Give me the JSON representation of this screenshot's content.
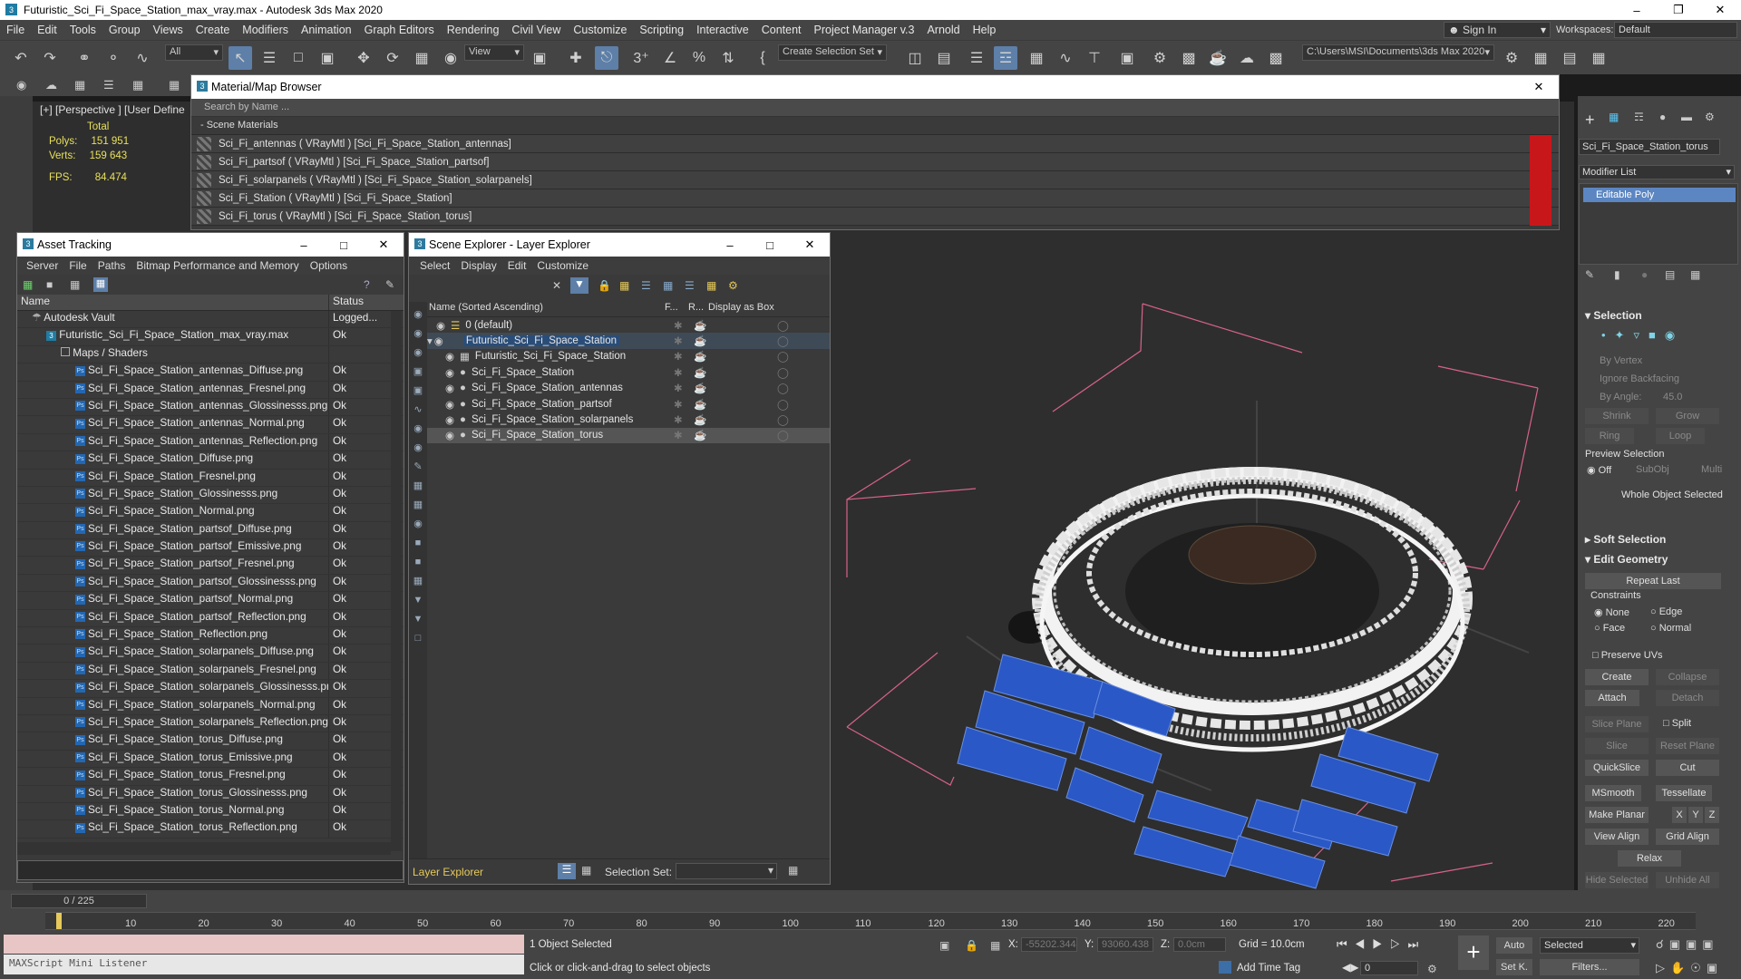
{
  "window": {
    "title": "Futuristic_Sci_Fi_Space_Station_max_vray.max - Autodesk 3ds Max 2020"
  },
  "menu": [
    "File",
    "Edit",
    "Tools",
    "Group",
    "Views",
    "Create",
    "Modifiers",
    "Animation",
    "Graph Editors",
    "Rendering",
    "Civil View",
    "Customize",
    "Scripting",
    "Interactive",
    "Content",
    "Project Manager v.3",
    "Arnold",
    "Help"
  ],
  "account": {
    "sign_in": "Sign In",
    "workspaces_label": "Workspaces:",
    "workspace": "Default"
  },
  "toolbar": {
    "filter": "All",
    "view": "View",
    "selection_set": "Create Selection Set",
    "project_path": "C:\\Users\\MSI\\Documents\\3ds Max 2020"
  },
  "viewport": {
    "label": "[+] [Perspective ] [User Define",
    "stats_total": "Total",
    "polys_label": "Polys:",
    "polys": "151 951",
    "verts_label": "Verts:",
    "verts": "159 643",
    "fps_label": "FPS:",
    "fps": "84.474"
  },
  "material_browser": {
    "title": "Material/Map Browser",
    "search": "Search by Name ...",
    "group": "- Scene Materials",
    "rows": [
      "Sci_Fi_antennas  ( VRayMtl )  [Sci_Fi_Space_Station_antennas]",
      "Sci_Fi_partsof  ( VRayMtl )  [Sci_Fi_Space_Station_partsof]",
      "Sci_Fi_solarpanels  ( VRayMtl )  [Sci_Fi_Space_Station_solarpanels]",
      "Sci_Fi_Station  ( VRayMtl )  [Sci_Fi_Space_Station]",
      "Sci_Fi_torus  ( VRayMtl )  [Sci_Fi_Space_Station_torus]"
    ]
  },
  "asset_tracking": {
    "title": "Asset Tracking",
    "menu": [
      "Server",
      "File",
      "Paths",
      "Bitmap Performance and Memory",
      "Options"
    ],
    "col_name": "Name",
    "col_status": "Status",
    "vault": "Autodesk Vault",
    "vault_status": "Logged...",
    "file": "Futuristic_Sci_Fi_Space_Station_max_vray.max",
    "file_status": "Ok",
    "maps_folder": "Maps / Shaders",
    "ok": "Ok",
    "files": [
      "Sci_Fi_Space_Station_antennas_Diffuse.png",
      "Sci_Fi_Space_Station_antennas_Fresnel.png",
      "Sci_Fi_Space_Station_antennas_Glossinesss.png",
      "Sci_Fi_Space_Station_antennas_Normal.png",
      "Sci_Fi_Space_Station_antennas_Reflection.png",
      "Sci_Fi_Space_Station_Diffuse.png",
      "Sci_Fi_Space_Station_Fresnel.png",
      "Sci_Fi_Space_Station_Glossinesss.png",
      "Sci_Fi_Space_Station_Normal.png",
      "Sci_Fi_Space_Station_partsof_Diffuse.png",
      "Sci_Fi_Space_Station_partsof_Emissive.png",
      "Sci_Fi_Space_Station_partsof_Fresnel.png",
      "Sci_Fi_Space_Station_partsof_Glossinesss.png",
      "Sci_Fi_Space_Station_partsof_Normal.png",
      "Sci_Fi_Space_Station_partsof_Reflection.png",
      "Sci_Fi_Space_Station_Reflection.png",
      "Sci_Fi_Space_Station_solarpanels_Diffuse.png",
      "Sci_Fi_Space_Station_solarpanels_Fresnel.png",
      "Sci_Fi_Space_Station_solarpanels_Glossinesss.png",
      "Sci_Fi_Space_Station_solarpanels_Normal.png",
      "Sci_Fi_Space_Station_solarpanels_Reflection.png",
      "Sci_Fi_Space_Station_torus_Diffuse.png",
      "Sci_Fi_Space_Station_torus_Emissive.png",
      "Sci_Fi_Space_Station_torus_Fresnel.png",
      "Sci_Fi_Space_Station_torus_Glossinesss.png",
      "Sci_Fi_Space_Station_torus_Normal.png",
      "Sci_Fi_Space_Station_torus_Reflection.png"
    ]
  },
  "scene_explorer": {
    "title": "Scene Explorer - Layer Explorer",
    "menu": [
      "Select",
      "Display",
      "Edit",
      "Customize"
    ],
    "col_name": "Name (Sorted Ascending)",
    "col_f": "F...",
    "col_r": "R...",
    "col_box": "Display as Box",
    "layer_default": "0 (default)",
    "layer_main": "Futuristic_Sci_Fi_Space_Station",
    "objects": [
      "Futuristic_Sci_Fi_Space_Station",
      "Sci_Fi_Space_Station",
      "Sci_Fi_Space_Station_antennas",
      "Sci_Fi_Space_Station_partsof",
      "Sci_Fi_Space_Station_solarpanels",
      "Sci_Fi_Space_Station_torus"
    ],
    "footer_mode": "Layer Explorer",
    "selection_set_label": "Selection Set:"
  },
  "command_panel": {
    "object_name": "Sci_Fi_Space_Station_torus",
    "modifier_list": "Modifier List",
    "modifier": "Editable Poly",
    "selection": "Selection",
    "by_vertex": "By Vertex",
    "ignore_backfacing": "Ignore Backfacing",
    "by_angle": "By Angle:",
    "angle": "45.0",
    "shrink": "Shrink",
    "grow": "Grow",
    "ring": "Ring",
    "loop": "Loop",
    "preview_selection": "Preview Selection",
    "off": "Off",
    "subobj": "SubObj",
    "multi": "Multi",
    "whole_object": "Whole Object Selected",
    "soft_selection": "Soft Selection",
    "edit_geometry": "Edit Geometry",
    "repeat_last": "Repeat Last",
    "constraints": "Constraints",
    "none": "None",
    "edge": "Edge",
    "face": "Face",
    "normal": "Normal",
    "preserve_uvs": "Preserve UVs",
    "create": "Create",
    "collapse": "Collapse",
    "attach": "Attach",
    "detach": "Detach",
    "slice_plane": "Slice Plane",
    "split": "Split",
    "slice": "Slice",
    "reset_plane": "Reset Plane",
    "quickslice": "QuickSlice",
    "cut": "Cut",
    "msmooth": "MSmooth",
    "tessellate": "Tessellate",
    "make_planar": "Make Planar",
    "x": "X",
    "y": "Y",
    "z": "Z",
    "view_align": "View Align",
    "grid_align": "Grid Align",
    "relax": "Relax",
    "hide_selected": "Hide Selected",
    "unhide_all": "Unhide All"
  },
  "timeline": {
    "frame": "0 / 225",
    "ticks": [
      "10",
      "20",
      "30",
      "40",
      "50",
      "60",
      "70",
      "80",
      "90",
      "100",
      "110",
      "120",
      "130",
      "140",
      "150",
      "160",
      "170",
      "180",
      "190",
      "200",
      "210",
      "220"
    ]
  },
  "status": {
    "listener": "MAXScript Mini Listener",
    "selected": "1 Object Selected",
    "hint": "Click or click-and-drag to select objects",
    "x_label": "X:",
    "x": "-55202.344",
    "y_label": "Y:",
    "y": "93060.438",
    "z_label": "Z:",
    "z": "0.0cm",
    "grid": "Grid = 10.0cm",
    "add_time_tag": "Add Time Tag",
    "auto": "Auto",
    "selected_combo": "Selected",
    "set_k": "Set K.",
    "filters": "Filters...",
    "frame_field": "0"
  }
}
